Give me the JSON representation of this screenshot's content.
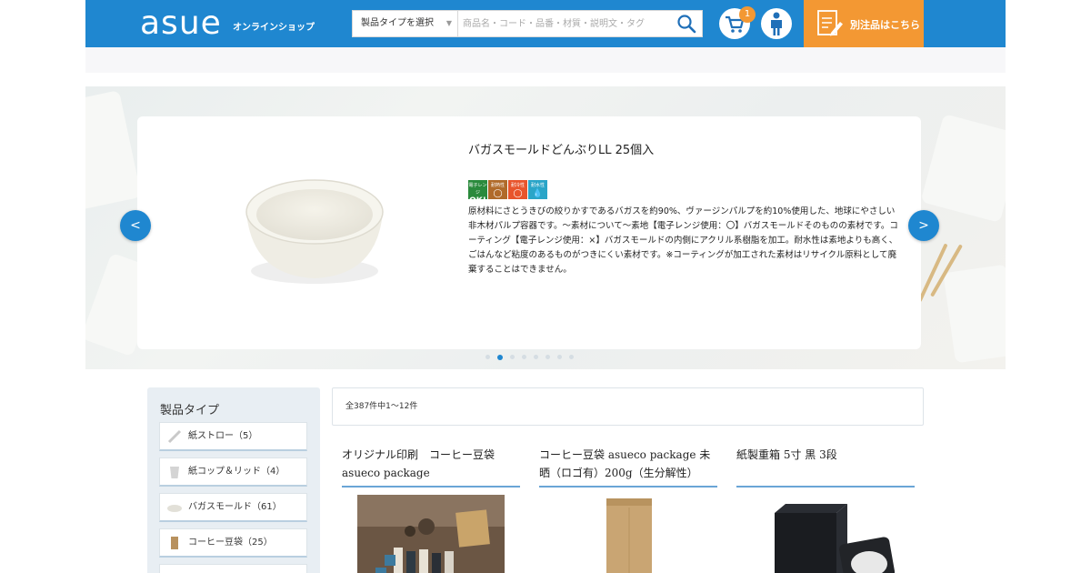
{
  "header": {
    "logo": "asue",
    "logo_sub": "オンラインショップ",
    "cart_count": "1",
    "order_button": "別注品はこちら",
    "brand_color": "#1f87d0",
    "accent_color": "#f39833"
  },
  "search": {
    "type_label": "製品タイプを選択",
    "placeholder": "商品名・コード・品番・材質・説明文・タグ"
  },
  "slider": {
    "title": "バガスモールドどんぶりLL 25個入",
    "badges": [
      {
        "top": "電子レンジ",
        "main": "OK!",
        "color": "#2a8a3c"
      },
      {
        "top": "耐熱性",
        "main": "◯",
        "color": "#b06a2a"
      },
      {
        "top": "耐冷性",
        "main": "◯",
        "color": "#e8552c"
      },
      {
        "top": "耐水性",
        "main": "💧",
        "color": "#2aa5c8"
      }
    ],
    "description": "原材料にさとうきびの絞りかすであるバガスを約90%、ヴァージンパルプを約10%使用した、地球にやさしい非木材パルプ容器です。～素材について～素地【電子レンジ使用：〇】バガスモールドそのものの素材です。コーティング【電子レンジ使用：×】バガスモールドの内側にアクリル系樹脂を加工。耐水性は素地よりも高く、ごはんなど粘度のあるものがつきにくい素材です。※コーティングが加工された素材はリサイクル原料として廃棄することはできません。",
    "prev_label": "<",
    "next_label": ">",
    "dot_count": 8,
    "active_dot": 1
  },
  "sidebar": {
    "title": "製品タイプ",
    "items": [
      {
        "label": "紙ストロー（5）"
      },
      {
        "label": "紙コップ＆リッド（4）"
      },
      {
        "label": "バガスモールド（61）"
      },
      {
        "label": "コーヒー豆袋（25）"
      }
    ]
  },
  "results": {
    "summary": "全387件中1〜12件"
  },
  "products": [
    {
      "title": "オリジナル印刷　コーヒー豆袋 asueco package"
    },
    {
      "title": "コーヒー豆袋 asueco package 未晒（ロゴ有）200g（生分解性）"
    },
    {
      "title": "紙製重箱 5寸 黒 3段"
    }
  ]
}
